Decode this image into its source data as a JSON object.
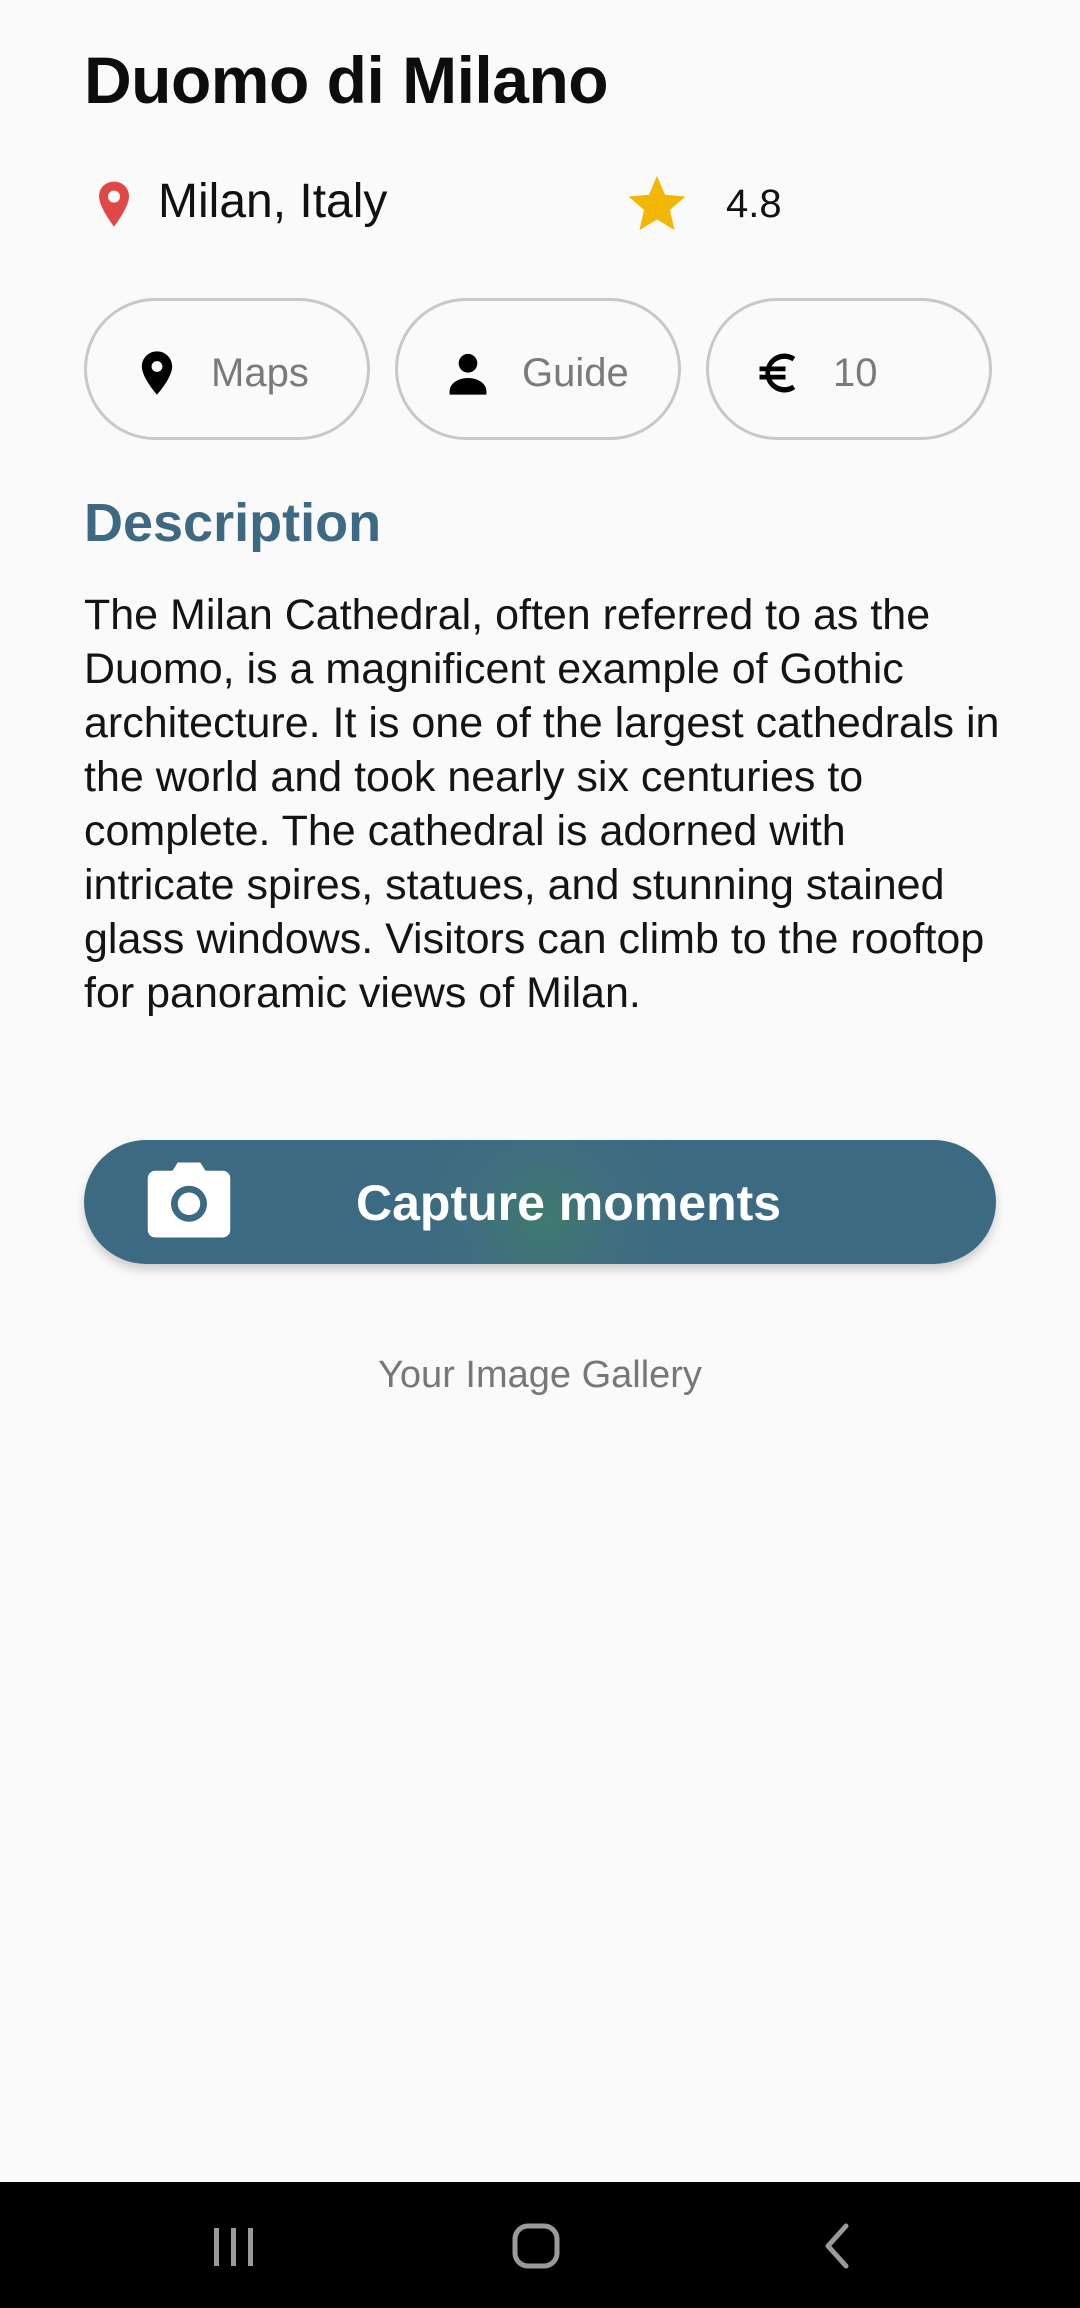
{
  "place": {
    "title": "Duomo di Milano",
    "location": "Milan, Italy",
    "rating": "4.8"
  },
  "chips": {
    "maps_label": "Maps",
    "guide_label": "Guide",
    "price_label": "10"
  },
  "description": {
    "heading": "Description",
    "text": "The Milan Cathedral, often referred to as the Duomo, is a magnificent example of Gothic architecture. It is one of the largest cathedrals in the world and took nearly six centuries to complete. The cathedral is adorned with intricate spires, statues, and stunning stained glass windows. Visitors can climb to the rooftop for panoramic views of Milan."
  },
  "capture": {
    "label": "Capture moments"
  },
  "gallery": {
    "label": "Your Image Gallery"
  },
  "icons": {
    "location": "location-pin-icon",
    "rating": "star-icon",
    "maps": "map-pin-icon",
    "guide": "person-icon",
    "price": "euro-icon",
    "capture": "camera-icon",
    "nav_recent": "recent-apps-icon",
    "nav_home": "home-icon",
    "nav_back": "back-icon"
  },
  "colors": {
    "accent": "#3b6a82",
    "pin": "#e04848",
    "star": "#f2b705"
  }
}
